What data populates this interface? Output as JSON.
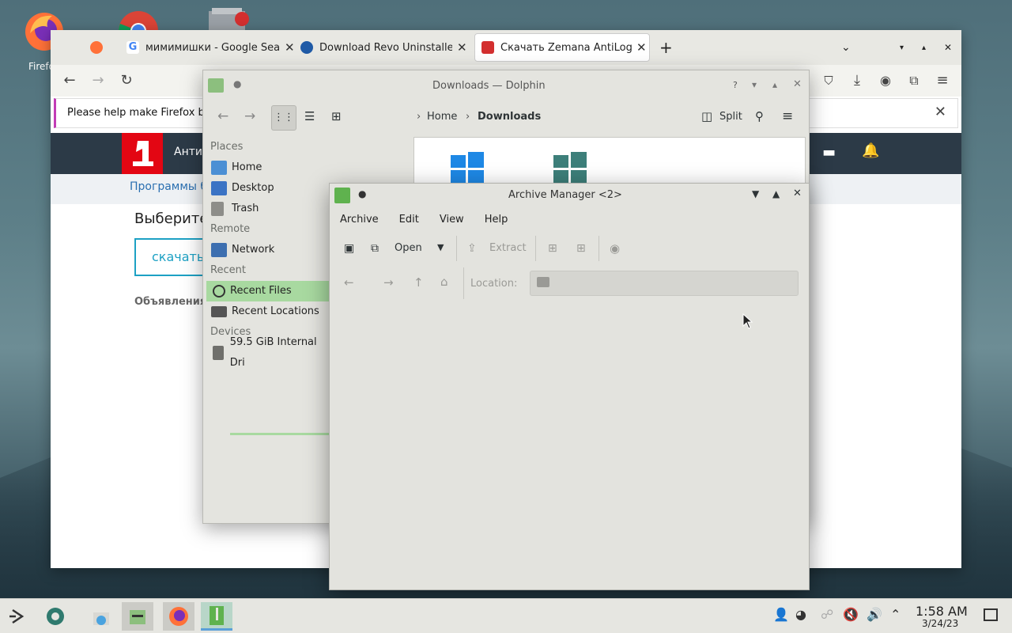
{
  "desktop": {
    "firefox_icon_label": "Firefox"
  },
  "firefox": {
    "tabs": [
      {
        "title": "мимимишки - Google Sear",
        "favicon_color": "#4285f4"
      },
      {
        "title": "Download Revo Uninstaller",
        "favicon_color": "#1f5aa6"
      },
      {
        "title": "Скачать Zemana AntiLogge",
        "favicon_color": "#d32f2f"
      }
    ],
    "new_tab_symbol": "+",
    "notification_text": "Please help make Firefox be",
    "page": {
      "header_text": "Анти",
      "sub_link": "Программы бе",
      "heading": "Выберите",
      "download_button": "скачать",
      "ads_label": "Объявления"
    },
    "accent_color": "#c23cb6"
  },
  "dolphin": {
    "title": "Downloads — Dolphin",
    "breadcrumb_home": "Home",
    "breadcrumb_current": "Downloads",
    "split_label": "Split",
    "help_symbol": "?",
    "places_header": "Places",
    "places": [
      {
        "label": "Home",
        "icon": "home-folder-icon"
      },
      {
        "label": "Desktop",
        "icon": "desktop-folder-icon"
      },
      {
        "label": "Trash",
        "icon": "trash-icon"
      }
    ],
    "remote_header": "Remote",
    "remote": [
      {
        "label": "Network",
        "icon": "network-icon"
      }
    ],
    "recent_header": "Recent",
    "recent": [
      {
        "label": "Recent Files",
        "icon": "clock-icon",
        "selected": true
      },
      {
        "label": "Recent Locations",
        "icon": "recent-locations-icon",
        "selected": false
      }
    ],
    "devices_header": "Devices",
    "devices": [
      {
        "label": "59.5 GiB Internal Dri",
        "icon": "drive-icon"
      }
    ],
    "selection_color": "#a8d9a0"
  },
  "archive_manager": {
    "title": "Archive Manager <2>",
    "menu": [
      "Archive",
      "Edit",
      "View",
      "Help"
    ],
    "open_label": "Open",
    "extract_label": "Extract",
    "location_label": "Location:",
    "location_value": ""
  },
  "taskbar": {
    "time": "1:58 AM",
    "date": "3/24/23",
    "active_color": "#5aa0d9"
  }
}
